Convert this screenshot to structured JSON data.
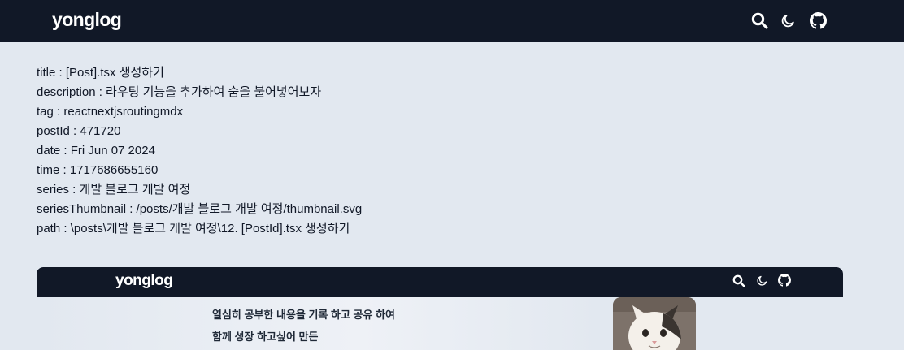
{
  "header": {
    "brand": "yonglog",
    "icons": [
      "search-icon",
      "moon-icon",
      "github-icon"
    ]
  },
  "post_meta": [
    "title : [Post].tsx 생성하기",
    "description : 라우팅 기능을 추가하여 숨을 불어넣어보자",
    "tag : reactnextjsroutingmdx",
    "postId : 471720",
    "date : Fri Jun 07 2024",
    "time : 1717686655160",
    "series : 개발 블로그 개발 여정",
    "seriesThumbnail : /posts/개발 블로그 개발 여정/thumbnail.svg",
    "path : \\posts\\개발 블로그 개발 여정\\12. [PostId].tsx 생성하기"
  ],
  "preview": {
    "brand": "yonglog",
    "intro_lines": [
      "열심히 공부한 내용을 기록 하고 공유 하여",
      "함께 성장 하고싶어 만든"
    ],
    "avatar": "cat-avatar-image"
  },
  "colors": {
    "header_bg": "#111827",
    "page_bg": "#e2e8f0",
    "text": "#111827"
  }
}
